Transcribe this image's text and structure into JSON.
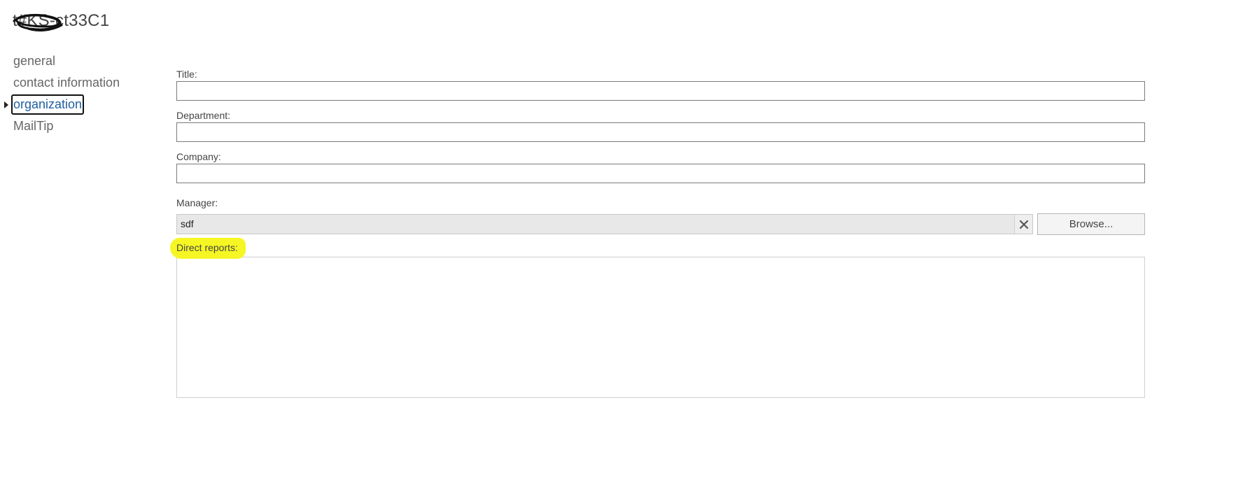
{
  "header": {
    "title": "t#KS-ct33C1"
  },
  "nav": {
    "items": [
      {
        "label": "general",
        "selected": false
      },
      {
        "label": "contact information",
        "selected": false
      },
      {
        "label": "organization",
        "selected": true
      },
      {
        "label": "MailTip",
        "selected": false
      }
    ]
  },
  "form": {
    "title": {
      "label": "Title:",
      "value": ""
    },
    "department": {
      "label": "Department:",
      "value": ""
    },
    "company": {
      "label": "Company:",
      "value": ""
    },
    "manager": {
      "label": "Manager:",
      "value": "sdf",
      "browse_label": "Browse..."
    },
    "direct_reports": {
      "label": "Direct reports:",
      "highlight_color": "#f6f624"
    }
  },
  "colors": {
    "selected_nav_text": "#1f5f9e",
    "highlight": "#f6f624"
  }
}
